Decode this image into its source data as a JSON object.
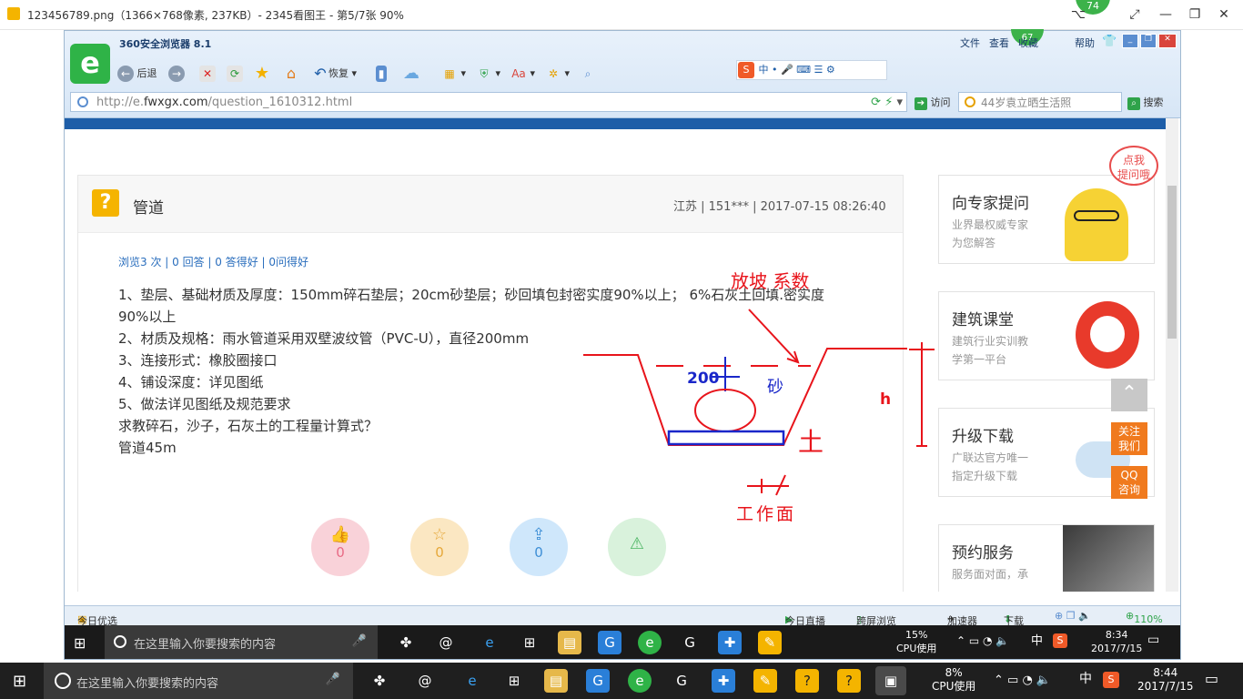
{
  "viewer": {
    "title": "123456789.png（1366×768像素, 237KB）- 2345看图王 - 第5/7张 90%",
    "badge": "74"
  },
  "browser": {
    "name": "360安全浏览器 8.1",
    "badge": "67",
    "menu": [
      "文件",
      "查看",
      "收藏",
      "帮助"
    ],
    "toolbar": {
      "back": "后退",
      "restore": "恢复"
    },
    "url_prefix": "http://e.",
    "url_domain": "fwxgx.com",
    "url_path": "/question_1610312.html",
    "visit": "访问",
    "search_placeholder": "44岁袁立晒生活照",
    "search_btn": "搜索"
  },
  "question": {
    "title": "管道",
    "meta": "江苏 | 151*** | 2017-07-15 08:26:40",
    "stats": "浏览3 次 | 0 回答 | 0 答得好 | 0问得好",
    "lines": [
      "1、垫层、基础材质及厚度：150mm碎石垫层；20cm砂垫层；砂回填包封密实度90%以上；  6%石灰土回填.密实度",
      "90%以上",
      "2、材质及规格：雨水管道采用双壁波纹管（PVC-U），直径200mm",
      "3、连接形式：橡胶圈接口",
      "4、铺设深度：详见图纸",
      "5、做法详见图纸及规范要求",
      "求教碎石，沙子，石灰土的工程量计算式？",
      "管道45m"
    ],
    "actions": [
      {
        "count": "0",
        "color": "#f9d2d9",
        "fg": "#e86a85",
        "icon": "👍"
      },
      {
        "count": "0",
        "color": "#fbe7c2",
        "fg": "#e6a83a",
        "icon": "☆"
      },
      {
        "count": "0",
        "color": "#cfe7fb",
        "fg": "#3e8fd6",
        "icon": "⇪"
      },
      {
        "count": "0",
        "color": "#d9f2dc",
        "fg": "#4bb562",
        "icon": "⚠"
      }
    ]
  },
  "sketch": {
    "slope_label": "放坡 系数",
    "dim_200": "200",
    "sand": "砂",
    "h": "h",
    "work_face": "工作面",
    "soil": "土"
  },
  "sidebar": {
    "bubble": "点我\n提问哦",
    "blocks": [
      {
        "title": "向专家提问",
        "desc1": "业界最权威专家",
        "desc2": "为您解答"
      },
      {
        "title": "建筑课堂",
        "desc1": "建筑行业实训教",
        "desc2": "学第一平台"
      },
      {
        "title": "升级下载",
        "desc1": "广联达官方唯一",
        "desc2": "指定升级下载"
      },
      {
        "title": "预约服务",
        "desc1": "服务面对面，承",
        "desc2": ""
      }
    ],
    "follow": "关注\n我们",
    "qq": "QQ\n咨询"
  },
  "status": {
    "today": "今日优选",
    "live": "今日直播",
    "cast": "跨屏浏览",
    "accel": "加速器",
    "download": "下载",
    "zoom": "110%"
  },
  "inner_taskbar": {
    "search": "在这里输入你要搜索的内容",
    "cpu": "15%",
    "cpu_label": "CPU使用",
    "ime": "中",
    "time": "8:34",
    "date": "2017/7/15"
  },
  "taskbar": {
    "search": "在这里输入你要搜索的内容",
    "cpu": "8%",
    "cpu_label": "CPU使用",
    "ime": "中",
    "time": "8:44",
    "date": "2017/7/15"
  },
  "colors": {
    "accent": "#1e5ea8",
    "orange": "#f07a1e",
    "sketch_red": "#e8141b",
    "sketch_blue": "#1a27c9"
  }
}
